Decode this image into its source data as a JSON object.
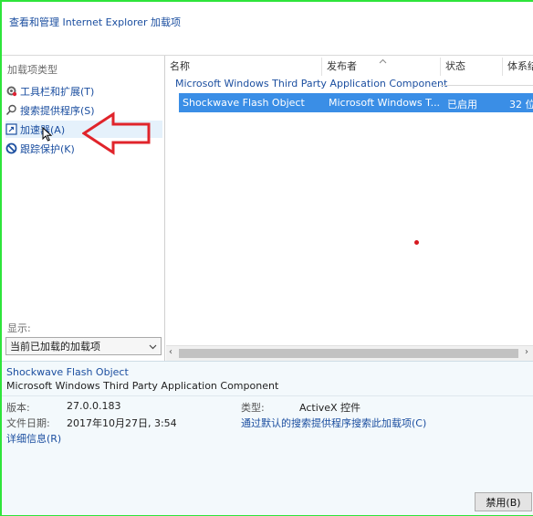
{
  "window": {
    "title": "查看和管理 Internet Explorer 加载项"
  },
  "sidebar": {
    "heading": "加载项类型",
    "items": [
      {
        "label": "工具栏和扩展(T)",
        "icon": "gear-icon"
      },
      {
        "label": "搜索提供程序(S)",
        "icon": "search-icon"
      },
      {
        "label": "加速器(A)",
        "icon": "accelerator-icon"
      },
      {
        "label": "跟踪保护(K)",
        "icon": "block-icon"
      }
    ],
    "show_label": "显示:",
    "show_value": "当前已加载的加载项"
  },
  "list": {
    "columns": [
      "名称",
      "发布者",
      "状态",
      "体系结"
    ],
    "group": "Microsoft Windows Third Party Application Component",
    "rows": [
      {
        "name": "Shockwave Flash Object",
        "publisher": "Microsoft Windows T...",
        "status": "已启用",
        "arch": "32 位"
      }
    ]
  },
  "details": {
    "name": "Shockwave Flash Object",
    "publisher": "Microsoft Windows Third Party Application Component",
    "version_label": "版本:",
    "version_value": "27.0.0.183",
    "date_label": "文件日期:",
    "date_value": "2017年10月27日, 3:54",
    "type_label": "类型:",
    "type_value": "ActiveX 控件",
    "more_info": "详细信息(R)",
    "search_link": "通过默认的搜索提供程序搜索此加载项(C)",
    "disable_button": "禁用(B)"
  },
  "colors": {
    "highlight_border": "#2ee43a",
    "selected_row": "#3a8ee6",
    "link": "#1c4fa0",
    "annotation_arrow": "#e0242b"
  }
}
